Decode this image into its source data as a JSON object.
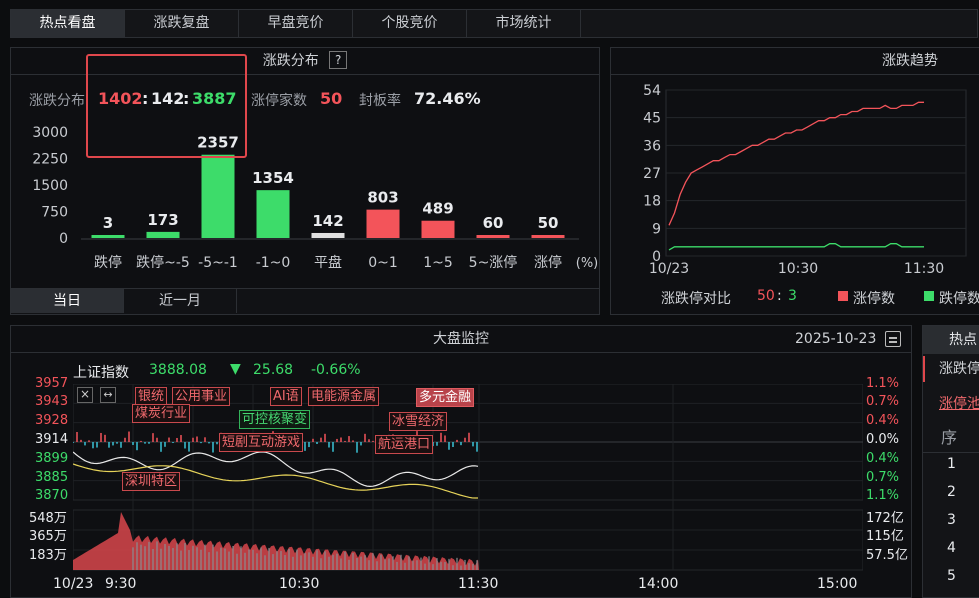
{
  "tabs": [
    "热点看盘",
    "涨跌复盘",
    "早盘竞价",
    "个股竞价",
    "市场统计"
  ],
  "dist": {
    "title": "涨跌分布",
    "help": "?",
    "label": "涨跌分布",
    "up": "1402",
    "sep1": ":",
    "flat": "142",
    "sep2": ":",
    "down": "3887",
    "limitup_label": "涨停家数",
    "limitup_value": "50",
    "seal_label": "封板率",
    "seal_value": "72.46%",
    "unit": "(%)",
    "subtabs": [
      "当日",
      "近一月"
    ]
  },
  "trend": {
    "title": "涨跌趋势",
    "ratio_label": "涨跌停对比",
    "ratio_up": "50",
    "ratio_sep": ":",
    "ratio_down": "3",
    "legend_up": "涨停数",
    "legend_down": "跌停数"
  },
  "monitor": {
    "title": "大盘监控",
    "date": "2025-10-23",
    "index_name": "上证指数",
    "index_value": "3888.08",
    "change_arrow": "▼",
    "change": "25.68",
    "change_pct": "-0.66%",
    "price_labels": [
      "3957",
      "3943",
      "3928",
      "3914",
      "3899",
      "3885",
      "3870"
    ],
    "pct_labels": [
      "1.1%",
      "0.7%",
      "0.4%",
      "0.0%",
      "0.4%",
      "0.7%",
      "1.1%"
    ],
    "vol_labels": [
      "548万",
      "365万",
      "183万"
    ],
    "amt_labels": [
      "172亿",
      "115亿",
      "57.5亿"
    ],
    "time_labels": [
      "10/23",
      "9:30",
      "10:30",
      "11:30",
      "14:00",
      "15:00"
    ],
    "tags": [
      "银统",
      "公用事业",
      "煤炭行业",
      "AI语",
      "电能源金属",
      "多元金融",
      "可控核聚变",
      "冰雪经济",
      "短剧互动游戏",
      "航运港口",
      "深圳特区"
    ],
    "tool_x": "×",
    "tool_arrows": "↔"
  },
  "side": {
    "title": "热点",
    "item1": "涨跌停",
    "item2": "涨停池",
    "col": "序",
    "rows": [
      "1",
      "2",
      "3",
      "4",
      "5"
    ]
  },
  "colors": {
    "up": "#f3545a",
    "down": "#3ddc6a",
    "flat": "#e0e0e0"
  },
  "chart_data": [
    {
      "type": "bar",
      "title": "涨跌分布",
      "categories": [
        "跌停",
        "跌停~-5",
        "-5~-1",
        "-1~0",
        "平盘",
        "0~1",
        "1~5",
        "5~涨停",
        "涨停"
      ],
      "values": [
        3,
        173,
        2357,
        1354,
        142,
        803,
        489,
        60,
        50
      ],
      "value_labels": [
        "3",
        "173",
        "2357",
        "1354",
        "142",
        "803",
        "489",
        "60",
        "50"
      ],
      "colors": [
        "down",
        "down",
        "down",
        "down",
        "flat",
        "up",
        "up",
        "up",
        "up"
      ],
      "yticks": [
        "3000",
        "2250",
        "1500",
        "750",
        "0"
      ],
      "ylim": [
        0,
        3000
      ],
      "xlabel": "(%)"
    },
    {
      "type": "line",
      "title": "涨跌趋势",
      "xticks": [
        "10/23",
        "10:30",
        "11:30"
      ],
      "yticks": [
        "54",
        "45",
        "36",
        "27",
        "18",
        "9",
        "0"
      ],
      "ylim": [
        0,
        54
      ],
      "series": [
        {
          "name": "涨停数",
          "color": "up",
          "values": [
            10,
            14,
            20,
            24,
            27,
            28,
            29,
            30,
            31,
            31,
            32,
            33,
            33,
            34,
            35,
            36,
            36,
            37,
            38,
            38,
            39,
            40,
            40,
            41,
            41,
            42,
            43,
            44,
            44,
            45,
            45,
            46,
            46,
            47,
            47,
            48,
            48,
            48,
            48,
            49,
            48,
            48,
            49,
            49,
            49,
            50,
            50
          ]
        },
        {
          "name": "跌停数",
          "color": "down",
          "values": [
            2,
            3,
            3,
            3,
            3,
            3,
            3,
            3,
            3,
            3,
            3,
            3,
            3,
            3,
            3,
            3,
            3,
            3,
            3,
            3,
            3,
            3,
            3,
            3,
            3,
            3,
            3,
            3,
            3,
            4,
            4,
            3,
            3,
            3,
            3,
            3,
            3,
            3,
            3,
            3,
            4,
            4,
            3,
            3,
            3,
            3,
            3
          ]
        }
      ]
    }
  ]
}
